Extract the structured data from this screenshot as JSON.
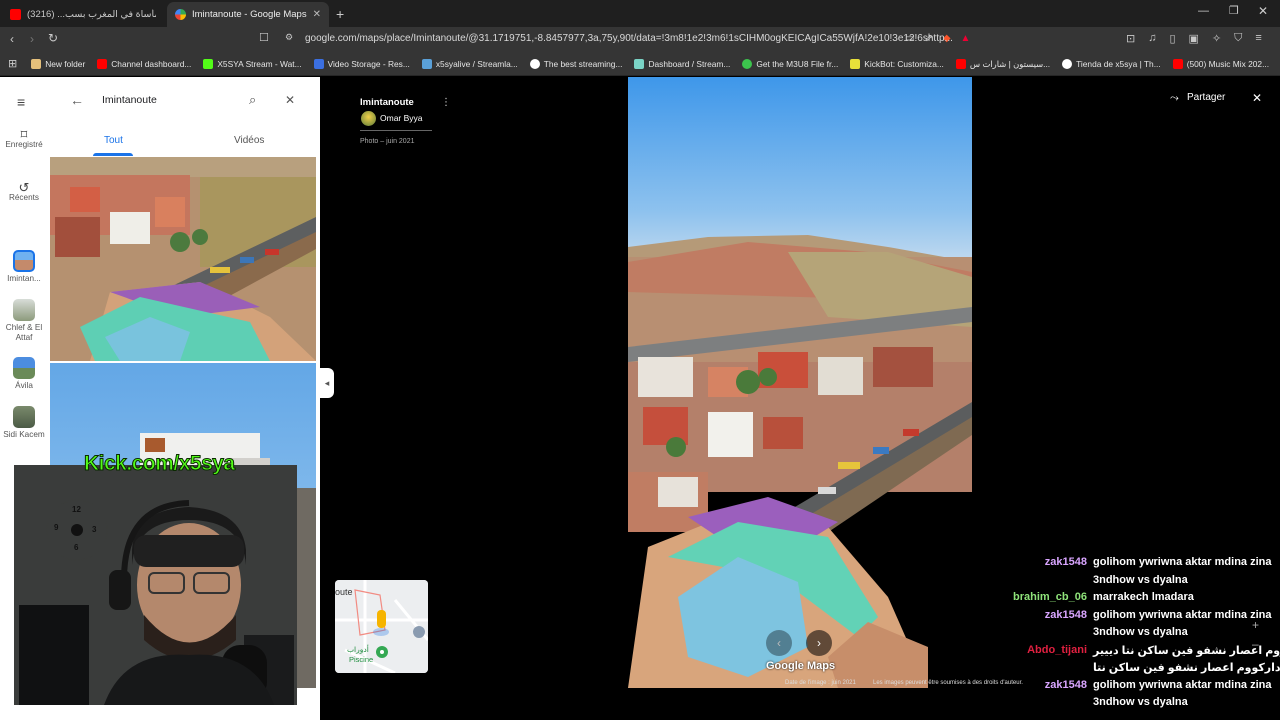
{
  "browser": {
    "tabs": [
      {
        "title": "شبكات| مأساة في المغرب بسب... (3216)",
        "active": false
      },
      {
        "title": "Imintanoute - Google Maps",
        "active": true
      }
    ],
    "url": "google.com/maps/place/Imintanoute/@31.1719751,-8.8457977,3a,75y,90t/data=!3m8!1e2!3m6!1sCIHM0ogKEICAgICa55WjfA!2e10!3e12!6shttp...",
    "bookmarks": [
      "New folder",
      "Channel dashboard...",
      "X5SYA Stream - Wat...",
      "Video Storage - Res...",
      "x5syalive / Streamla...",
      "The best streaming...",
      "Dashboard / Stream...",
      "Get the M3U8 File fr...",
      "KickBot: Customiza...",
      "سيستون | شارات س...",
      "Tienda de x5sya | Th...",
      "(500) Music Mix 202..."
    ]
  },
  "maps": {
    "rail": {
      "saved": "Enregistré",
      "recent": "Récents",
      "places": [
        "Imintan...",
        "Chlef & El Attaf",
        "Ávila",
        "Sidi Kacem"
      ]
    },
    "search_value": "Imintanoute",
    "tabs": [
      "Tout",
      "Vidéos"
    ],
    "photo": {
      "title": "Imintanoute",
      "author": "Omar Byya",
      "date": "Photo – juin 2021"
    },
    "share_label": "Partager",
    "minimap": {
      "place_partial": "oute",
      "label_ar": "أدوراب",
      "label_fr": "Piscine"
    },
    "watermark": "Google Maps",
    "footer": {
      "date": "Date de l'image : juin 2021",
      "rights": "Les images peuvent être soumises à des droits d'auteur."
    }
  },
  "stream": {
    "kick": "Kick.com/x5sya",
    "clock_numbers": [
      "12",
      "9",
      "3",
      "6"
    ],
    "chat": [
      {
        "user": "zak1548",
        "color": "#d9a5ff",
        "lines": [
          "golihom ywriwna aktar mdina zina",
          "3ndhow vs dyalna"
        ]
      },
      {
        "user": "brahim_cb_06",
        "color": "#8fe37a",
        "lines": [
          "marrakech lmadara"
        ]
      },
      {
        "user": "zak1548",
        "color": "#d9a5ff",
        "lines": [
          "golihom ywriwna aktar mdina zina",
          "3ndhow vs dyalna"
        ]
      },
      {
        "user": "Abdo_tijani",
        "color": "#e02040",
        "lines": [
          "دييير داركووم اعصار نشفو فين ساكن نتا دييير",
          "داركووم اعصار نشفو فين ساكن نتا"
        ]
      },
      {
        "user": "zak1548",
        "color": "#d9a5ff",
        "lines": [
          "golihom ywriwna aktar mdina zina",
          "3ndhow vs dyalna"
        ]
      }
    ]
  },
  "colors": {
    "accent": "#1a73e8",
    "kick_green": "#53fc18"
  }
}
